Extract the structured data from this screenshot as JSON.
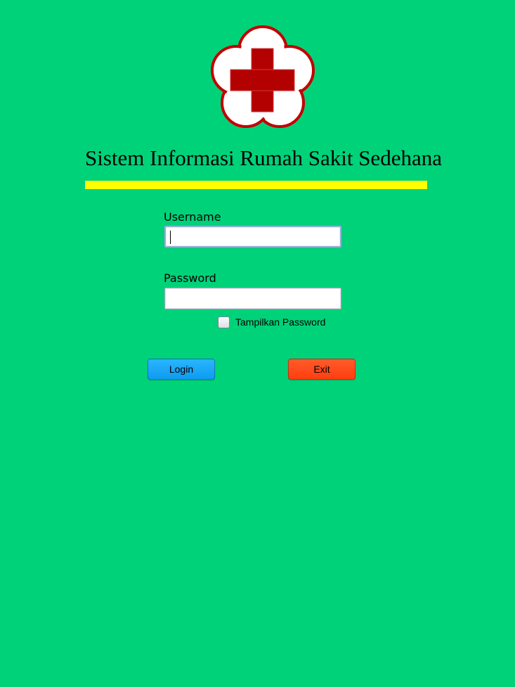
{
  "app": {
    "title": "Sistem Informasi Rumah Sakit Sedehana",
    "logo_icon": "red-cross-flower-icon"
  },
  "form": {
    "username_label": "Username",
    "username_value": "",
    "password_label": "Password",
    "password_value": "",
    "show_password_label": "Tampilkan Password",
    "show_password_checked": false
  },
  "buttons": {
    "login_label": "Login",
    "exit_label": "Exit"
  },
  "colors": {
    "background": "#00d27a",
    "divider": "#ffff00",
    "logo_cross": "#b30000",
    "login_button": "#1aa8f7",
    "exit_button": "#ff4a1a"
  }
}
